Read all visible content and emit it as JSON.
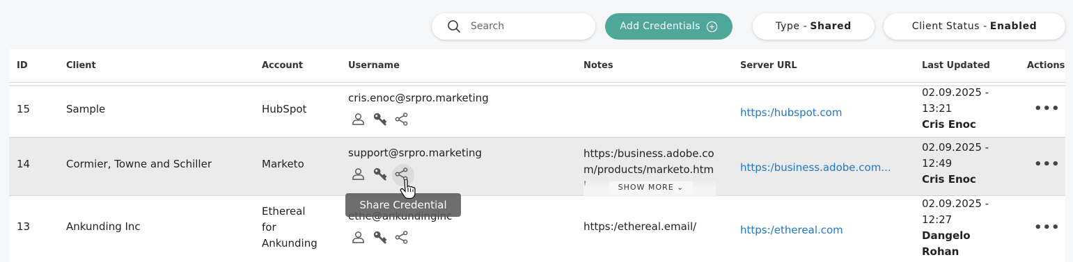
{
  "toolbar": {
    "search_placeholder": "Search",
    "add_label": "Add Credentials",
    "type_filter": {
      "label": "Type -",
      "value": "Shared"
    },
    "status_filter": {
      "label": "Client Status -",
      "value": "Enabled"
    }
  },
  "columns": [
    "ID",
    "Client",
    "Account",
    "Username",
    "Notes",
    "Server URL",
    "Last Updated",
    "Actions"
  ],
  "rows": [
    {
      "id": "15",
      "client": "Sample",
      "account": "HubSpot",
      "username": "cris.enoc@srpro.marketing",
      "notes": "",
      "server_url": "https:/hubspot.com",
      "updated_date": "02.09.2025 -",
      "updated_time": "13:21",
      "updated_by": "Cris Enoc",
      "actions": "•••"
    },
    {
      "id": "14",
      "client": "Cormier, Towne and Schiller",
      "account": "Marketo",
      "username": "support@srpro.marketing",
      "notes": "https:/business.adobe.com/products/marketo.html",
      "server_url": "https:/business.adobe.com...",
      "updated_date": "02.09.2025 -",
      "updated_time": "12:49",
      "updated_by": "Cris Enoc",
      "actions": "•••",
      "show_more": "SHOW MORE"
    },
    {
      "id": "13",
      "client": "Ankunding Inc",
      "account": "Ethereal\nfor\nAnkunding",
      "account_lines": [
        "Ethereal",
        "for",
        "Ankunding"
      ],
      "username": "ethe@ankundinginc",
      "notes": "https:/ethereal.email/",
      "server_url": "https:/ethereal.com",
      "updated_date": "02.09.2025 -",
      "updated_time": "12:27",
      "updated_by_lines": [
        "Dangelo",
        "Rohan"
      ],
      "actions": "•••"
    }
  ],
  "tooltip": "Share Credential",
  "icons": {
    "search": "search-icon",
    "add": "plus-circle-icon",
    "user": "user-icon",
    "key": "key-icon",
    "share": "share-icon",
    "more": "more-horizontal-icon"
  },
  "colors": {
    "accent": "#4fa79a",
    "link": "#2476c8",
    "highlight_row": "#ebebeb"
  }
}
